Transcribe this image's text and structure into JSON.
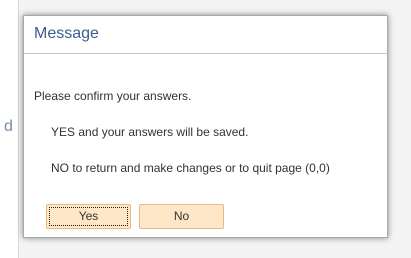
{
  "background": {
    "glyph": "d"
  },
  "dialog": {
    "title": "Message",
    "lines": [
      "Please confirm your answers.",
      "YES and your answers will be saved.",
      "NO to return and make changes or to quit page (0,0)"
    ],
    "buttons": {
      "yes_label": "Yes",
      "no_label": "No"
    }
  },
  "colors": {
    "title": "#3c5b8f",
    "button_fill": "#fde7c6",
    "button_border": "#e8b985"
  }
}
